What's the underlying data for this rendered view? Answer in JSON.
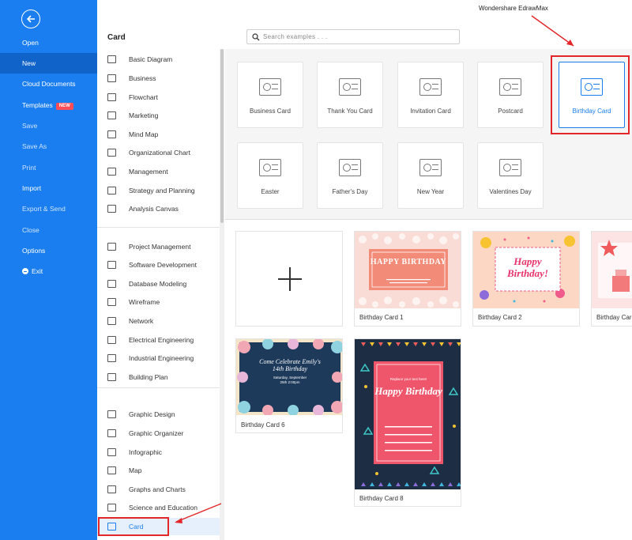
{
  "annotation": "Wondershare EdrawMax",
  "sidebar": {
    "items": [
      {
        "label": "Open"
      },
      {
        "label": "New"
      },
      {
        "label": "Cloud Documents"
      },
      {
        "label": "Templates",
        "badge": "NEW"
      },
      {
        "label": "Save"
      },
      {
        "label": "Save As"
      },
      {
        "label": "Print"
      },
      {
        "label": "Import"
      },
      {
        "label": "Export & Send"
      },
      {
        "label": "Close"
      },
      {
        "label": "Options"
      },
      {
        "label": "Exit"
      }
    ]
  },
  "category_panel": {
    "title": "Card",
    "items": [
      "Basic Diagram",
      "Business",
      "Flowchart",
      "Marketing",
      "Mind Map",
      "Organizational Chart",
      "Management",
      "Strategy and Planning",
      "Analysis Canvas",
      "Project Management",
      "Software Development",
      "Database Modeling",
      "Wireframe",
      "Network",
      "Electrical Engineering",
      "Industrial Engineering",
      "Building Plan",
      "Graphic Design",
      "Graphic Organizer",
      "Infographic",
      "Map",
      "Graphs and Charts",
      "Science and Education",
      "Card"
    ]
  },
  "search": {
    "placeholder": "Search examples . . ."
  },
  "templates": [
    {
      "label": "Business Card",
      "icon": "business-card-icon"
    },
    {
      "label": "Thank You Card",
      "icon": "thank-you-card-icon"
    },
    {
      "label": "Invitation Card",
      "icon": "invitation-card-icon"
    },
    {
      "label": "Postcard",
      "icon": "postcard-icon"
    },
    {
      "label": "Birthday Card",
      "icon": "birthday-cake-icon"
    },
    {
      "label": "Easter",
      "icon": "easter-egg-icon"
    },
    {
      "label": "Father's Day",
      "icon": "mustache-icon"
    },
    {
      "label": "New Year",
      "icon": "fireworks-icon"
    },
    {
      "label": "Valentines Day",
      "icon": "calendar-heart-icon"
    }
  ],
  "examples": [
    {
      "label": "Birthday Card 1",
      "thumb": {
        "title": "HAPPY BIRTHDAY"
      }
    },
    {
      "label": "Birthday Card 2",
      "thumb": {
        "title": "Happy Birthday!"
      }
    },
    {
      "label": "Birthday Card",
      "thumb": {}
    },
    {
      "label": "Birthday Card 6",
      "thumb": {
        "title": "Come Celebrate Emily's 14th Birthday",
        "date": "Saturday, September",
        "time": "25th 2:00pm"
      }
    },
    {
      "label": "Birthday Card 8",
      "thumb": {
        "title": "Happy Birthday",
        "line": "Replace your text here!"
      }
    }
  ],
  "colors": {
    "accent": "#1a7ef0",
    "sidebar": "#1a7ef0",
    "annotation_red": "#e2262a"
  }
}
